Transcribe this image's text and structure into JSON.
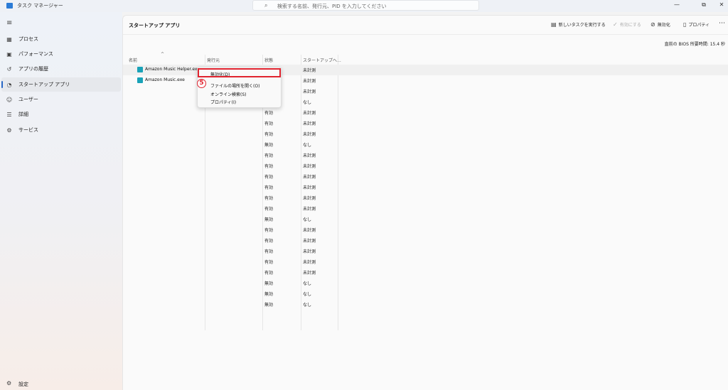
{
  "window": {
    "title": "タスク マネージャー",
    "search_placeholder": "検索する名前、発行元、PID を入力してください",
    "minimize": "—",
    "maximize": "⧉",
    "close": "✕"
  },
  "sidebar": {
    "items": [
      {
        "label": "プロセス",
        "icon": "grid-icon"
      },
      {
        "label": "パフォーマンス",
        "icon": "performance-icon"
      },
      {
        "label": "アプリの履歴",
        "icon": "history-icon"
      },
      {
        "label": "スタートアップ アプリ",
        "icon": "speedometer-icon",
        "active": true
      },
      {
        "label": "ユーザー",
        "icon": "users-icon"
      },
      {
        "label": "詳細",
        "icon": "list-icon"
      },
      {
        "label": "サービス",
        "icon": "puzzle-icon"
      }
    ],
    "settings_label": "設定"
  },
  "header": {
    "title": "スタートアップ アプリ",
    "new_task": "新しいタスクを実行する",
    "enable": "有効にする",
    "disable": "無効化",
    "properties": "プロパティ",
    "more": "⋯"
  },
  "bios_time": "直前の BIOS 所要時間:  15.4 秒",
  "columns": {
    "name": "名前",
    "publisher": "発行元",
    "status": "状態",
    "impact": "スタートアップへ..."
  },
  "rows": [
    {
      "name": "Amazon Music Helper.exe",
      "status": "",
      "impact": "未計測"
    },
    {
      "name": "Amazon Music.exe",
      "status": "",
      "impact": "未計測"
    },
    {
      "name": "",
      "status": "",
      "impact": "未計測"
    },
    {
      "name": "",
      "status": "",
      "impact": "なし"
    },
    {
      "name": "",
      "status": "有効",
      "impact": "未計測"
    },
    {
      "name": "",
      "status": "有効",
      "impact": "未計測"
    },
    {
      "name": "",
      "status": "有効",
      "impact": "未計測"
    },
    {
      "name": "",
      "status": "無効",
      "impact": "なし"
    },
    {
      "name": "",
      "status": "有効",
      "impact": "未計測"
    },
    {
      "name": "",
      "status": "有効",
      "impact": "未計測"
    },
    {
      "name": "",
      "status": "有効",
      "impact": "未計測"
    },
    {
      "name": "",
      "status": "有効",
      "impact": "未計測"
    },
    {
      "name": "",
      "status": "有効",
      "impact": "未計測"
    },
    {
      "name": "",
      "status": "有効",
      "impact": "未計測"
    },
    {
      "name": "",
      "status": "無効",
      "impact": "なし"
    },
    {
      "name": "",
      "status": "有効",
      "impact": "未計測"
    },
    {
      "name": "",
      "status": "有効",
      "impact": "未計測"
    },
    {
      "name": "",
      "status": "有効",
      "impact": "未計測"
    },
    {
      "name": "",
      "status": "有効",
      "impact": "未計測"
    },
    {
      "name": "",
      "status": "有効",
      "impact": "未計測"
    },
    {
      "name": "",
      "status": "無効",
      "impact": "なし"
    },
    {
      "name": "",
      "status": "無効",
      "impact": "なし"
    },
    {
      "name": "",
      "status": "無効",
      "impact": "なし"
    }
  ],
  "context_menu": {
    "items": [
      "無効化(D)",
      "ファイルの場所を開く(O)",
      "オンライン検索(S)",
      "プロパティ(I)"
    ]
  },
  "step_badge": "5",
  "colors": {
    "accent": "#2867c5",
    "highlight": "#e0242f",
    "app_icon": "#19a2b8"
  }
}
